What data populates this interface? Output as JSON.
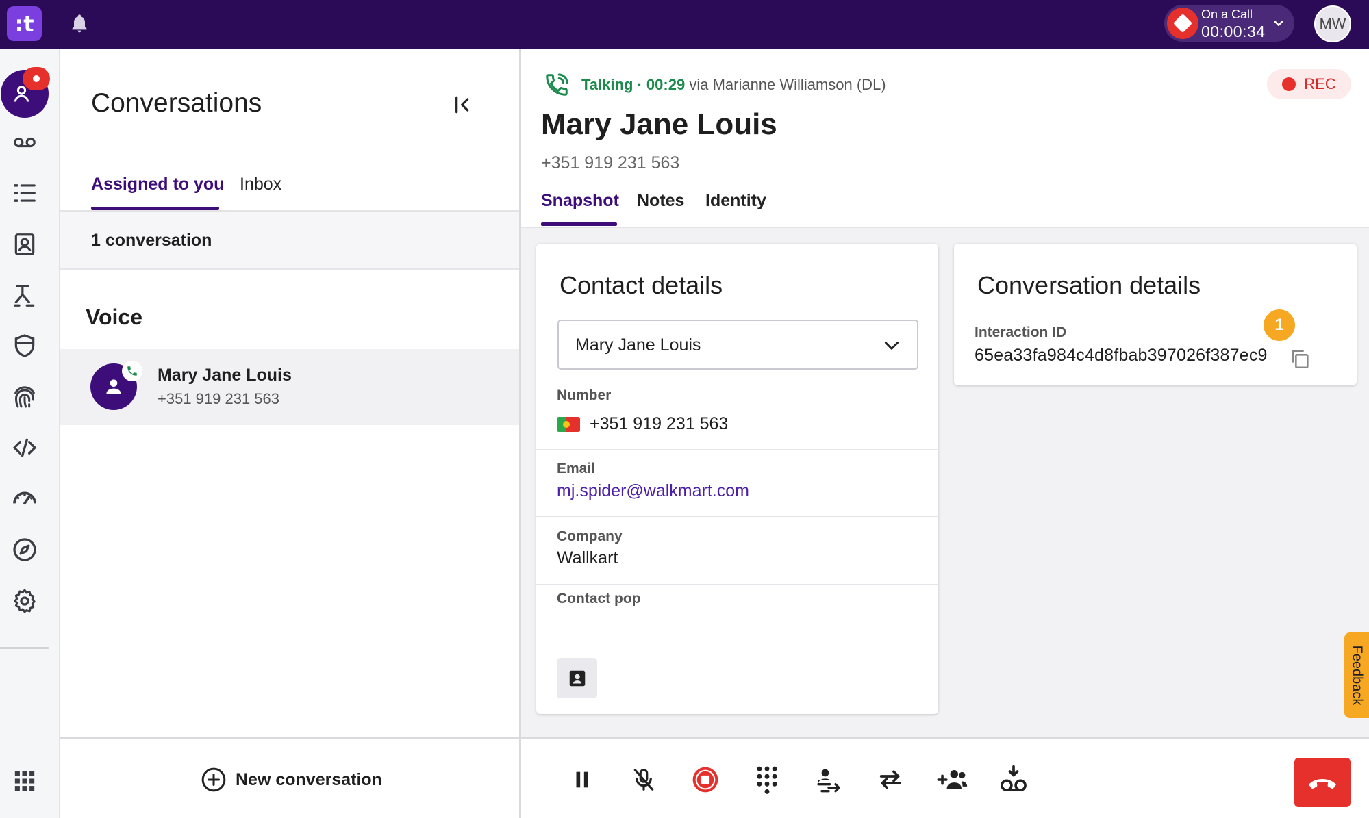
{
  "topbar": {
    "logo_text": ":t",
    "call_status_label": "On a Call",
    "call_timer": "00:00:34",
    "user_initials": "MW"
  },
  "rail": {
    "items": [
      "agent-icon",
      "voicemail-icon",
      "list-icon",
      "contacts-icon",
      "routing-icon",
      "shield-icon",
      "fingerprint-icon",
      "code-icon",
      "dashboard-icon",
      "compass-icon",
      "gear-icon",
      "apps-grid-icon"
    ]
  },
  "conversations": {
    "title": "Conversations",
    "tabs": [
      {
        "label": "Assigned to you",
        "active": true
      },
      {
        "label": "Inbox",
        "active": false
      }
    ],
    "count_label": "1 conversation",
    "section_heading": "Voice",
    "items": [
      {
        "name": "Mary Jane Louis",
        "number": "+351 919 231 563"
      }
    ],
    "new_conversation_label": "New conversation"
  },
  "call": {
    "status": "Talking · 00:29",
    "via": "via Marianne Williamson (DL)",
    "rec_label": "REC",
    "contact_name": "Mary Jane Louis",
    "contact_number": "+351 919 231 563",
    "tabs": [
      {
        "label": "Snapshot",
        "active": true
      },
      {
        "label": "Notes",
        "active": false
      },
      {
        "label": "Identity",
        "active": false
      }
    ]
  },
  "contact_details": {
    "title": "Contact details",
    "selected_contact": "Mary Jane Louis",
    "number_label": "Number",
    "number_value": "+351 919 231 563",
    "email_label": "Email",
    "email_value": "mj.spider@walkmart.com",
    "company_label": "Company",
    "company_value": "Wallkart",
    "contact_pop_label": "Contact pop"
  },
  "conversation_details": {
    "title": "Conversation details",
    "badge_count": "1",
    "interaction_id_label": "Interaction ID",
    "interaction_id_value": "65ea33fa984c4d8fbab397026f387ec9"
  },
  "feedback_label": "Feedback",
  "colors": {
    "brand_dark": "#2b0a57",
    "brand_primary": "#3d0d7a",
    "danger": "#e5302b",
    "talking_green": "#1b8a4c",
    "warning": "#f7a823"
  }
}
